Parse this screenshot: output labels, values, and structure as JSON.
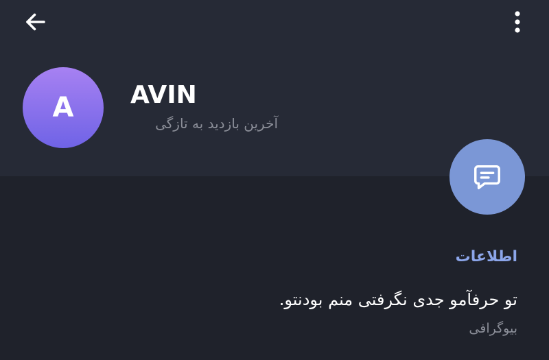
{
  "header": {
    "back_icon": "arrow-left-icon",
    "menu_icon": "more-vertical-icon"
  },
  "profile": {
    "avatar_letter": "A",
    "avatar_gradient": [
      "#a781f2",
      "#6f63e6"
    ],
    "name": "AVIN",
    "last_seen": "آخرین بازدید به تازگی"
  },
  "fab": {
    "icon": "message-icon",
    "color": "#7b97d6"
  },
  "info": {
    "section_title": "اطلاعات",
    "bio": "تو حرفآمو جدی نگرفتی منم بودنتو.",
    "bio_label": "بیوگرافی"
  },
  "colors": {
    "background": "#1f222b",
    "header_background": "#262a36",
    "accent": "#8ca6ea"
  }
}
